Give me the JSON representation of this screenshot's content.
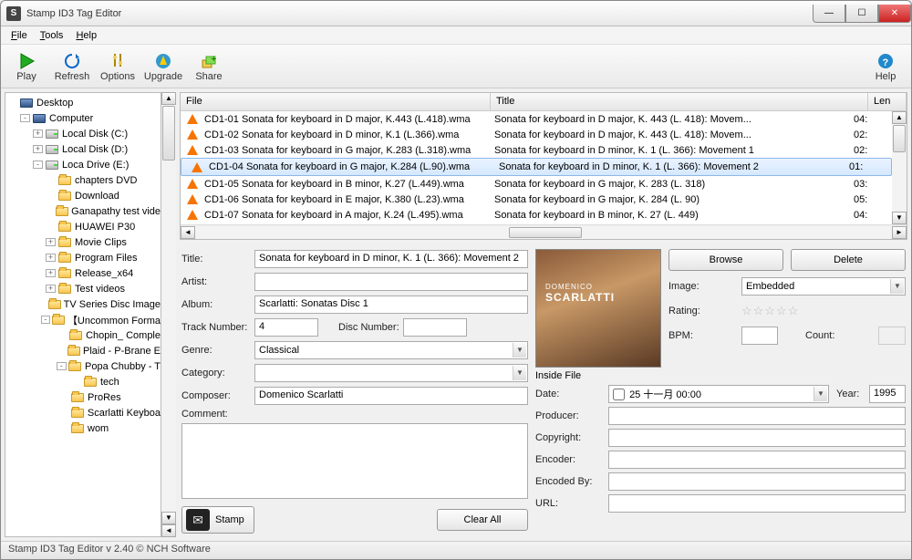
{
  "window": {
    "title": "Stamp ID3 Tag Editor"
  },
  "menu": {
    "file": "File",
    "tools": "Tools",
    "help": "Help"
  },
  "toolbar": {
    "play": "Play",
    "refresh": "Refresh",
    "options": "Options",
    "upgrade": "Upgrade",
    "share": "Share",
    "helpBtn": "Help"
  },
  "tree": [
    {
      "depth": 0,
      "tw": "",
      "icon": "monitor",
      "label": "Desktop"
    },
    {
      "depth": 1,
      "tw": "-",
      "icon": "monitor",
      "label": "Computer"
    },
    {
      "depth": 2,
      "tw": "+",
      "icon": "drive",
      "label": "Local Disk (C:)"
    },
    {
      "depth": 2,
      "tw": "+",
      "icon": "drive",
      "label": "Local Disk (D:)"
    },
    {
      "depth": 2,
      "tw": "-",
      "icon": "drive",
      "label": "Loca Drive (E:)"
    },
    {
      "depth": 3,
      "tw": "",
      "icon": "folder",
      "label": "chapters DVD"
    },
    {
      "depth": 3,
      "tw": "",
      "icon": "folder",
      "label": "Download"
    },
    {
      "depth": 3,
      "tw": "",
      "icon": "folder",
      "label": "Ganapathy test vide"
    },
    {
      "depth": 3,
      "tw": "",
      "icon": "folder",
      "label": "HUAWEI P30"
    },
    {
      "depth": 3,
      "tw": "+",
      "icon": "folder",
      "label": "Movie Clips"
    },
    {
      "depth": 3,
      "tw": "+",
      "icon": "folder",
      "label": "Program Files"
    },
    {
      "depth": 3,
      "tw": "+",
      "icon": "folder",
      "label": "Release_x64"
    },
    {
      "depth": 3,
      "tw": "+",
      "icon": "folder",
      "label": "Test videos"
    },
    {
      "depth": 3,
      "tw": "",
      "icon": "folder",
      "label": "TV Series Disc Image"
    },
    {
      "depth": 3,
      "tw": "-",
      "icon": "folder",
      "label": "【Uncommon Forma"
    },
    {
      "depth": 4,
      "tw": "",
      "icon": "folder",
      "label": "Chopin_ Comple"
    },
    {
      "depth": 4,
      "tw": "",
      "icon": "folder",
      "label": "Plaid - P-Brane E"
    },
    {
      "depth": 4,
      "tw": "-",
      "icon": "folder",
      "label": "Popa Chubby - T"
    },
    {
      "depth": 5,
      "tw": "",
      "icon": "folder",
      "label": "tech"
    },
    {
      "depth": 4,
      "tw": "",
      "icon": "folder",
      "label": "ProRes"
    },
    {
      "depth": 4,
      "tw": "",
      "icon": "folder",
      "label": "Scarlatti Keyboa"
    },
    {
      "depth": 4,
      "tw": "",
      "icon": "folder",
      "label": "wom"
    }
  ],
  "listHeaders": {
    "file": "File",
    "title": "Title",
    "len": "Len"
  },
  "files": [
    {
      "f": "CD1-01 Sonata for keyboard in D major, K.443 (L.418).wma",
      "t": "Sonata for keyboard in D major, K. 443 (L. 418): Movem...",
      "l": "04:"
    },
    {
      "f": "CD1-02 Sonata for keyboard in D minor, K.1 (L.366).wma",
      "t": "Sonata for keyboard in D major, K. 443 (L. 418): Movem...",
      "l": "02:"
    },
    {
      "f": "CD1-03 Sonata for keyboard in G major, K.283 (L.318).wma",
      "t": "Sonata for keyboard in D minor, K. 1 (L. 366): Movement 1",
      "l": "02:"
    },
    {
      "f": "CD1-04 Sonata for keyboard in G major, K.284 (L.90).wma",
      "t": "Sonata for keyboard in D minor, K. 1 (L. 366): Movement 2",
      "l": "01:"
    },
    {
      "f": "CD1-05 Sonata for keyboard in B minor, K.27 (L.449).wma",
      "t": "Sonata for keyboard in G major, K. 283 (L. 318)",
      "l": "03:"
    },
    {
      "f": "CD1-06 Sonata for keyboard in E major, K.380 (L.23).wma",
      "t": "Sonata for keyboard in G major, K. 284 (L. 90)",
      "l": "05:"
    },
    {
      "f": "CD1-07 Sonata for keyboard in A major, K.24 (L.495).wma",
      "t": "Sonata for keyboard in B minor, K. 27 (L. 449)",
      "l": "04:"
    }
  ],
  "selectedIndex": 3,
  "fields": {
    "titleLabel": "Title:",
    "titleVal": "Sonata for keyboard in D minor, K. 1 (L. 366): Movement 2",
    "artistLabel": "Artist:",
    "artistVal": "",
    "albumLabel": "Album:",
    "albumVal": "Scarlatti: Sonatas Disc 1",
    "trackLabel": "Track Number:",
    "trackVal": "4",
    "discLabel": "Disc Number:",
    "discVal": "",
    "genreLabel": "Genre:",
    "genreVal": "Classical",
    "categoryLabel": "Category:",
    "categoryVal": "",
    "composerLabel": "Composer:",
    "composerVal": "Domenico Scarlatti",
    "commentLabel": "Comment:",
    "browse": "Browse",
    "delete": "Delete",
    "imageLabel": "Image:",
    "imageVal": "Embedded",
    "ratingLabel": "Rating:",
    "bpmLabel": "BPM:",
    "bpmVal": "",
    "countLabel": "Count:",
    "insideFile": "Inside File",
    "dateLabel": "Date:",
    "dateVal": "25 十一月 00:00",
    "yearLabel": "Year:",
    "yearVal": "1995",
    "producerLabel": "Producer:",
    "copyrightLabel": "Copyright:",
    "encoderLabel": "Encoder:",
    "encodedByLabel": "Encoded By:",
    "urlLabel": "URL:",
    "stamp": "Stamp",
    "clearAll": "Clear All"
  },
  "albumArt": {
    "line1": "DOMENICO",
    "line2": "SCARLATTI"
  },
  "status": "Stamp ID3 Tag Editor v 2.40 © NCH Software"
}
